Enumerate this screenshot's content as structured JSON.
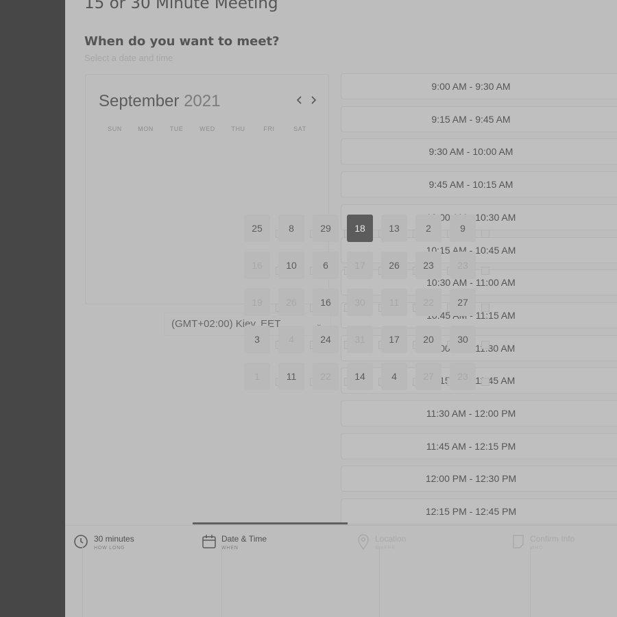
{
  "page": {
    "title": "15 or 30 Minute Meeting",
    "question": "When do you want to meet?",
    "subtitle": "Select a date and time"
  },
  "calendar": {
    "month": "September",
    "year": "2021",
    "weekdays": [
      "SUN",
      "MON",
      "TUE",
      "WED",
      "THU",
      "FRI",
      "SAT"
    ],
    "selected_day": "18",
    "grid": [
      [
        "25",
        "8",
        "29",
        "18",
        "13",
        "2",
        "9"
      ],
      [
        "16",
        "10",
        "6",
        "17",
        "26",
        "23",
        "23"
      ],
      [
        "19",
        "26",
        "16",
        "30",
        "11",
        "22",
        "27"
      ],
      [
        "3",
        "4",
        "24",
        "31",
        "17",
        "20",
        "30"
      ],
      [
        "1",
        "11",
        "22",
        "14",
        "4",
        "27",
        "23"
      ]
    ]
  },
  "timezone": {
    "label": "(GMT+02:00) Kiev, EET",
    "arrow_icon": "chevron-down-icon"
  },
  "time_slots": [
    "9:00 AM - 9:30 AM",
    "9:15 AM - 9:45 AM",
    "9:30 AM - 10:00 AM",
    "9:45 AM - 10:15 AM",
    "10:00 AM - 10:30 AM",
    "10:15 AM - 10:45 AM",
    "10:30 AM - 11:00 AM",
    "10:45 AM - 11:15 AM",
    "11:00 AM - 11:30 AM",
    "11:15 AM - 11:45 AM",
    "11:30 AM - 12:00 PM",
    "11:45 AM - 12:15 PM",
    "12:00 PM - 12:30 PM",
    "12:15 PM - 12:45 PM"
  ],
  "steps": [
    {
      "label": "30 minutes",
      "sub": "HOW LONG",
      "icon": "clock-icon",
      "active": true
    },
    {
      "label": "Date & Time",
      "sub": "WHEN",
      "icon": "calendar-icon",
      "active": true
    },
    {
      "label": "Location",
      "sub": "WHERE",
      "icon": "location-pin-icon",
      "active": false
    },
    {
      "label": "Confirm Info",
      "sub": "WHO",
      "icon": "form-icon",
      "active": false
    }
  ],
  "colors": {
    "overlay_bg": "#bdbdbd",
    "sidebar": "#474747",
    "selected_day": "#5c5c5c",
    "progress": "#5e5e5e"
  }
}
